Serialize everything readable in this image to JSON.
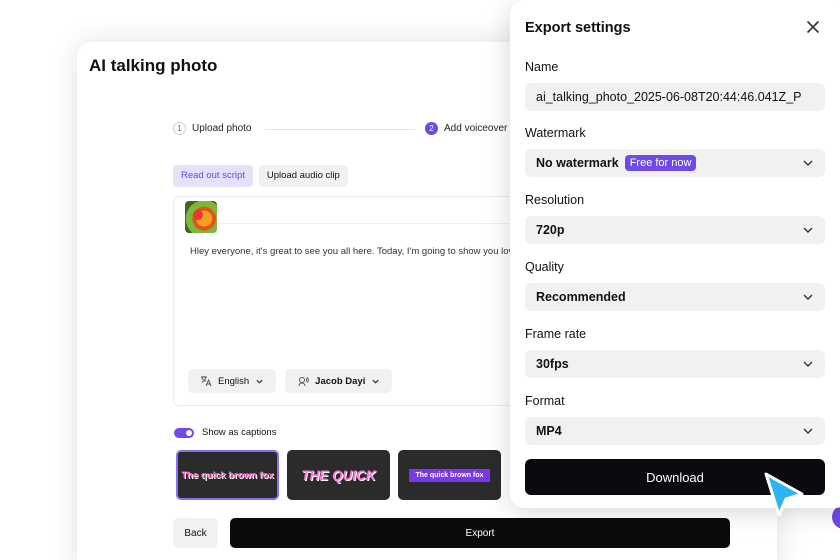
{
  "app": {
    "title": "AI talking photo"
  },
  "stepper": [
    {
      "number": "1",
      "label": "Upload photo"
    },
    {
      "number": "2",
      "label": "Add voiceover"
    }
  ],
  "script_tabs": [
    "Read out script",
    "Upload audio clip"
  ],
  "script": {
    "text": "Hley everyone, it's great to see you all here. Today, I'm going to show you love.",
    "language": "English",
    "voice": "Jacob Dayi"
  },
  "captions": {
    "label": "Show as captions",
    "enabled": true
  },
  "caption_styles": [
    "The quick brown fox",
    "THE QUICK",
    "The quick brown fox"
  ],
  "footer": {
    "back_label": "Back",
    "export_label": "Export"
  },
  "export_panel": {
    "title": "Export settings",
    "name_label": "Name",
    "name_value": "ai_talking_photo_2025-06-08T20:44:46.041Z_P",
    "watermark_label": "Watermark",
    "watermark_value": "No watermark",
    "watermark_badge": "Free for now",
    "resolution_label": "Resolution",
    "resolution_value": "720p",
    "quality_label": "Quality",
    "quality_value": "Recommended",
    "frame_rate_label": "Frame rate",
    "frame_rate_value": "30fps",
    "format_label": "Format",
    "format_value": "MP4",
    "download_label": "Download"
  },
  "colors": {
    "accent": "#6e4ae6",
    "primary_button": "#0b0b0f",
    "cursor": "#2db4f0"
  }
}
